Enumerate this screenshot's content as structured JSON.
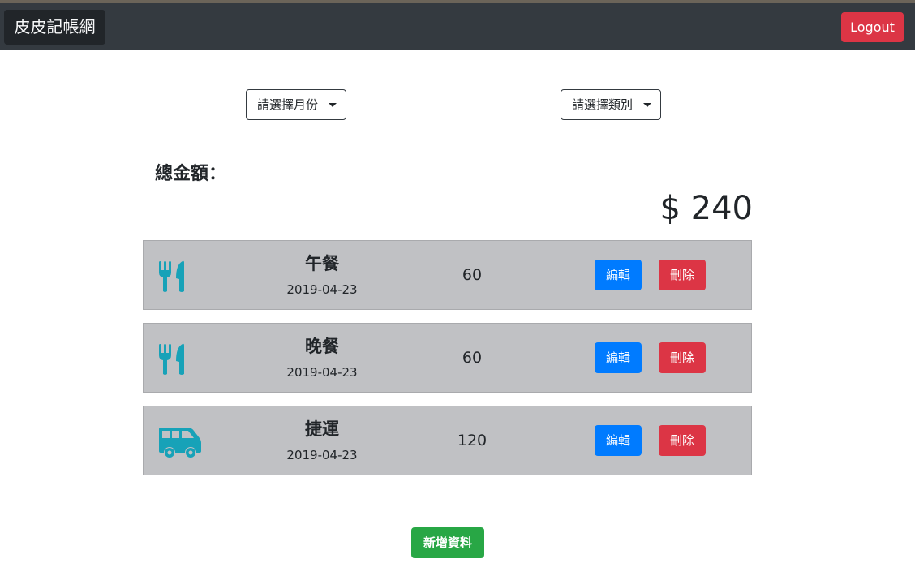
{
  "navbar": {
    "brand": "皮皮記帳網",
    "logout_label": "Logout"
  },
  "filters": {
    "month_label": "請選擇月份",
    "category_label": "請選擇類別"
  },
  "summary": {
    "total_label": "總金額：",
    "total_amount": "$ 240"
  },
  "records": [
    {
      "icon": "utensils-icon",
      "title": "午餐",
      "date": "2019-04-23",
      "amount": "60",
      "edit_label": "編輯",
      "delete_label": "刪除"
    },
    {
      "icon": "utensils-icon",
      "title": "晚餐",
      "date": "2019-04-23",
      "amount": "60",
      "edit_label": "編輯",
      "delete_label": "刪除"
    },
    {
      "icon": "shuttle-van-icon",
      "title": "捷運",
      "date": "2019-04-23",
      "amount": "120",
      "edit_label": "編輯",
      "delete_label": "刪除"
    }
  ],
  "add_label": "新增資料",
  "colors": {
    "navbar": "#343a40",
    "icon": "#17a2b8",
    "edit": "#007bff",
    "delete": "#dc3545",
    "add": "#28a745",
    "record_bg": "#c0c1c4"
  }
}
